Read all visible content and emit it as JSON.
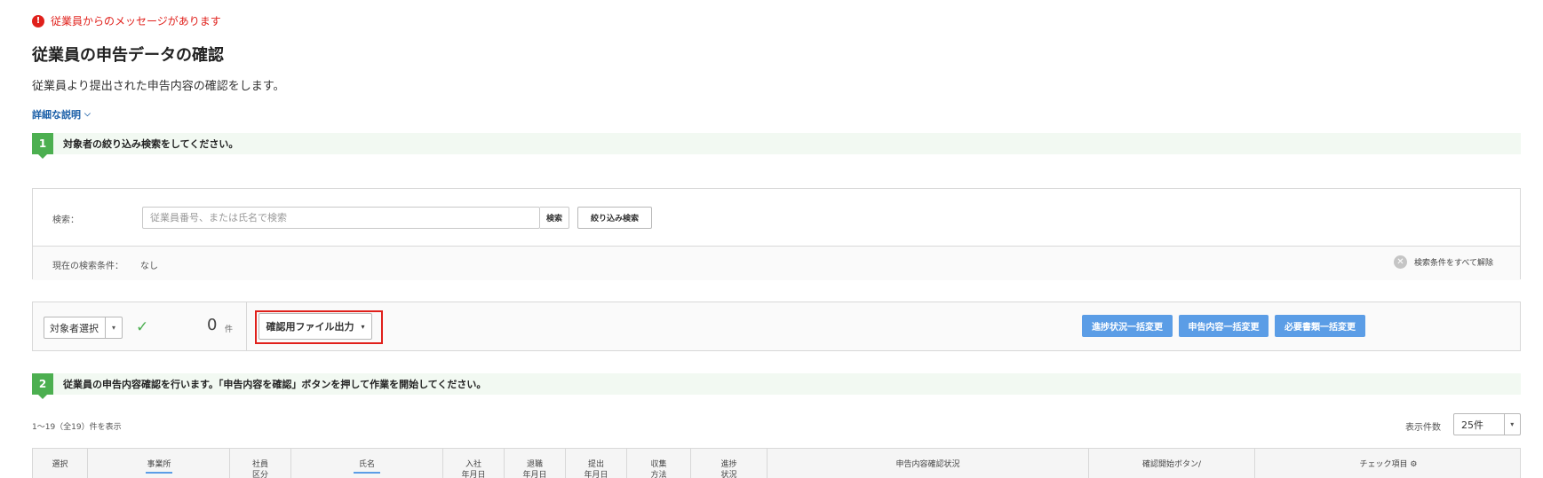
{
  "alert": {
    "icon": "exclamation-icon",
    "icon_glyph": "!",
    "message": "従業員からのメッセージがあります",
    "color": "#e0201b"
  },
  "page": {
    "title": "従業員の申告データの確認",
    "description": "従業員より提出された申告内容の確認をします。",
    "detail_link": "詳細な説明",
    "detail_chevron": "⌵"
  },
  "step1": {
    "number": "1",
    "text": "対象者の絞り込み検索をしてください。"
  },
  "search": {
    "label": "検索：",
    "placeholder": "従業員番号、または氏名で検索",
    "search_button": "検索",
    "narrow_button": "絞り込み検索",
    "condition_label": "現在の検索条件：",
    "condition_value": "なし",
    "clear_all": "検索条件をすべて解除",
    "clear_icon_glyph": "✕"
  },
  "actions": {
    "target_select": "対象者選択",
    "check_glyph": "✓",
    "count": "0",
    "count_unit": "件",
    "export_button": "確認用ファイル出力",
    "caret": "▾",
    "bulk_progress": "進捗状況一括変更",
    "bulk_content": "申告内容一括変更",
    "bulk_documents": "必要書類一括変更",
    "accent": "#5b9de6"
  },
  "step2": {
    "number": "2",
    "text": "従業員の申告内容確認を行います。「申告内容を確認」ボタンを押して作業を開始してください。"
  },
  "results": {
    "summary": "1〜19（全19）件を表示",
    "per_page_label": "表示件数",
    "per_page_value": "25件"
  },
  "table": {
    "headers": [
      [
        "選択"
      ],
      [
        "事業所"
      ],
      [
        "社員",
        "区分"
      ],
      [
        "氏名"
      ],
      [
        "入社",
        "年月日"
      ],
      [
        "退職",
        "年月日"
      ],
      [
        "提出",
        "年月日"
      ],
      [
        "収集",
        "方法"
      ],
      [
        "進捗",
        "状況"
      ],
      [
        "申告内容確認状況"
      ],
      [
        "確認開始ボタン/"
      ],
      [
        "チェック項目 ⚙"
      ]
    ]
  }
}
